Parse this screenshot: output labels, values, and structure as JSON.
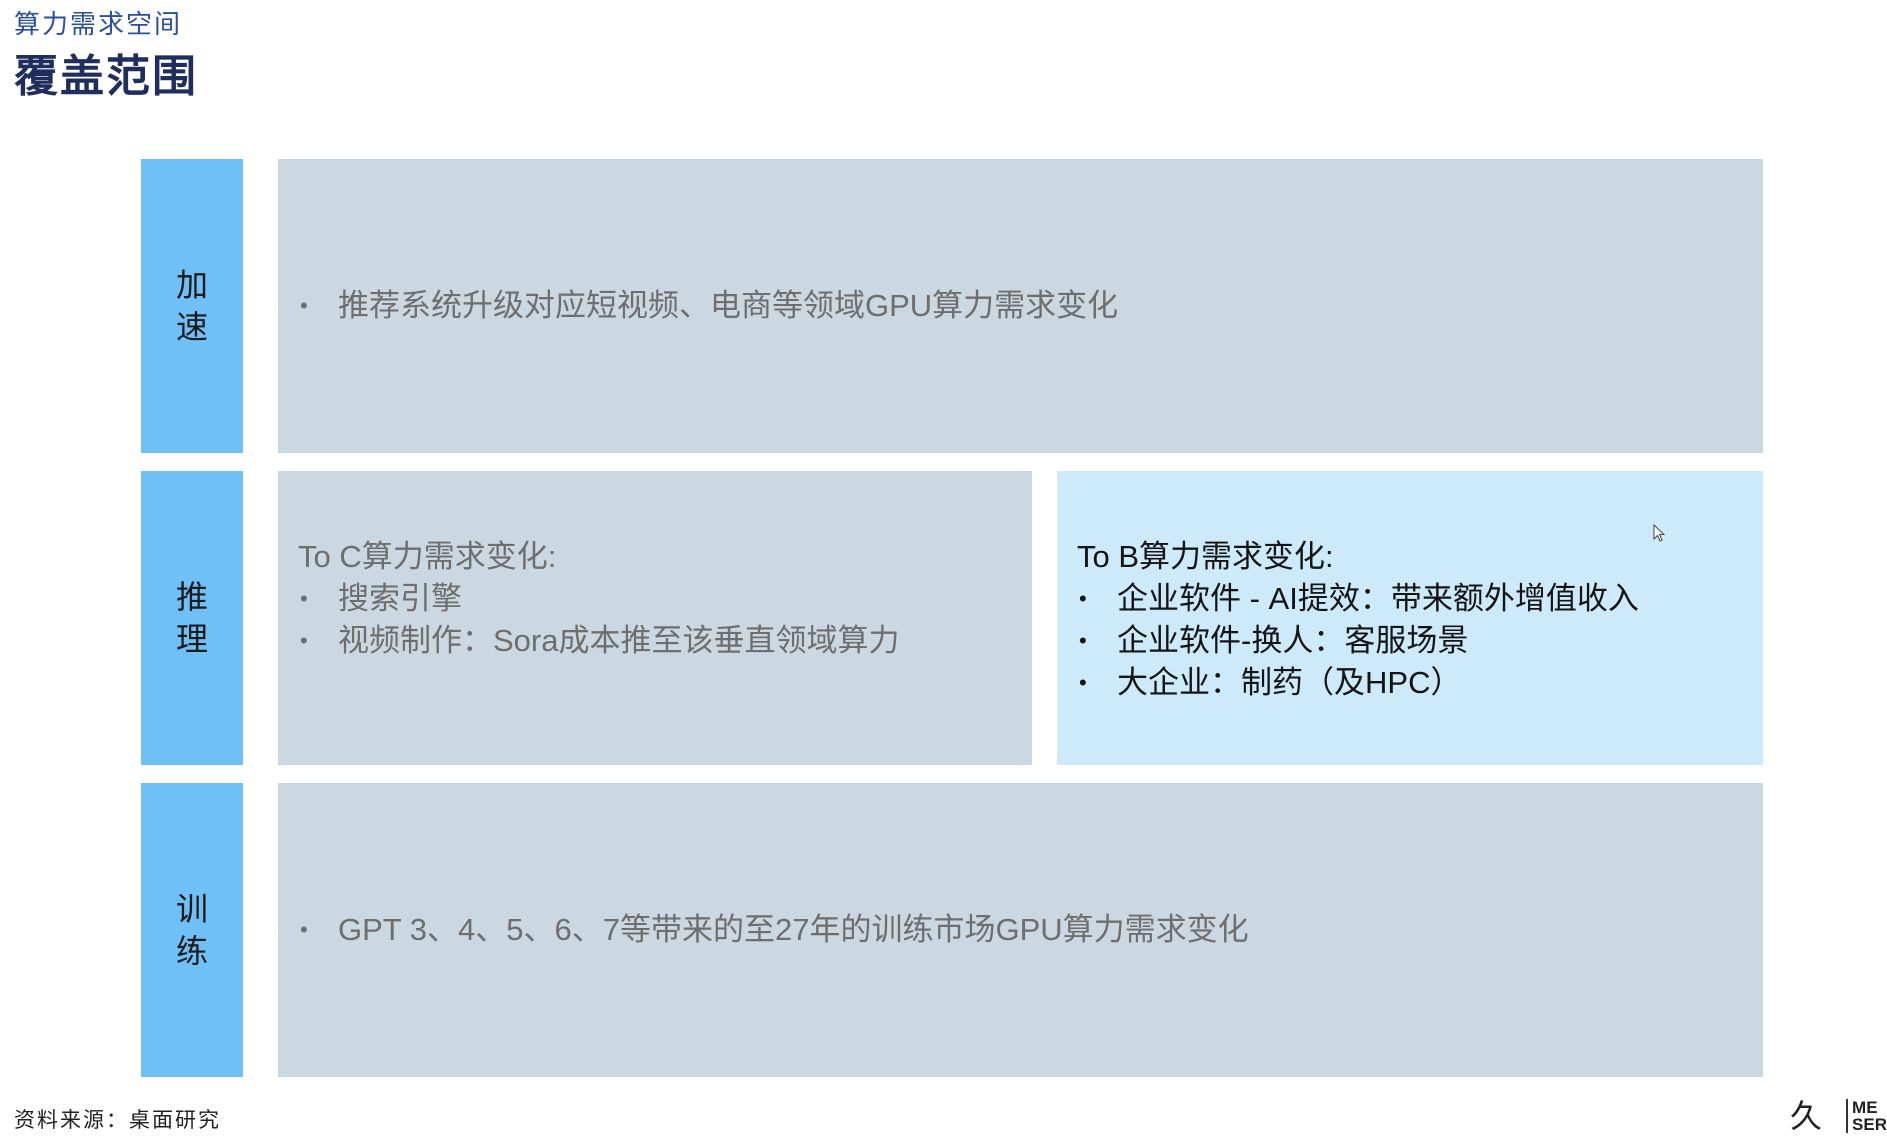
{
  "header": {
    "section_label": "算力需求空间",
    "title": "覆盖范围"
  },
  "rows": {
    "accelerate": {
      "tab_label": "加速",
      "bullets": [
        "推荐系统升级对应短视频、电商等领域GPU算力需求变化"
      ]
    },
    "inference": {
      "tab_label": "推理",
      "to_c": {
        "heading": "To C算力需求变化:",
        "bullets": [
          "搜索引擎",
          "视频制作：Sora成本推至该垂直领域算力"
        ]
      },
      "to_b": {
        "heading": "To B算力需求变化:",
        "bullets": [
          "企业软件 - AI提效：带来额外增值收入",
          "企业软件-换人：客服场景",
          "大企业：制药（及HPC）"
        ]
      }
    },
    "training": {
      "tab_label": "训练",
      "bullets": [
        "GPT 3、4、5、6、7等带来的至27年的训练市场GPU算力需求变化"
      ]
    }
  },
  "footer": {
    "source": "资料来源：桌面研究",
    "logo_mark": "久謙",
    "logo_line1": "ME",
    "logo_line2": "SER"
  },
  "bullet_glyph": "•",
  "colors": {
    "tab_blue": "#6fc0f7",
    "panel_gray": "#cbd8e1",
    "panel_light_blue": "#cdeafb",
    "title_navy": "#1f2e5c",
    "label_blue": "#2a4fa0"
  }
}
